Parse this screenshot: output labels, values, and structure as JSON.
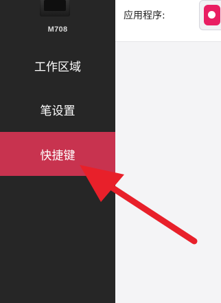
{
  "sidebar": {
    "device_name": "M708",
    "items": [
      {
        "label": "工作区域",
        "active": false
      },
      {
        "label": "笔设置",
        "active": false
      },
      {
        "label": "快捷键",
        "active": true
      }
    ]
  },
  "main": {
    "app_label": "应用程序:"
  },
  "colors": {
    "sidebar_bg": "#262626",
    "active_item": "#c8334f",
    "arrow": "#e8202a",
    "app_icon": "#e91e63"
  }
}
